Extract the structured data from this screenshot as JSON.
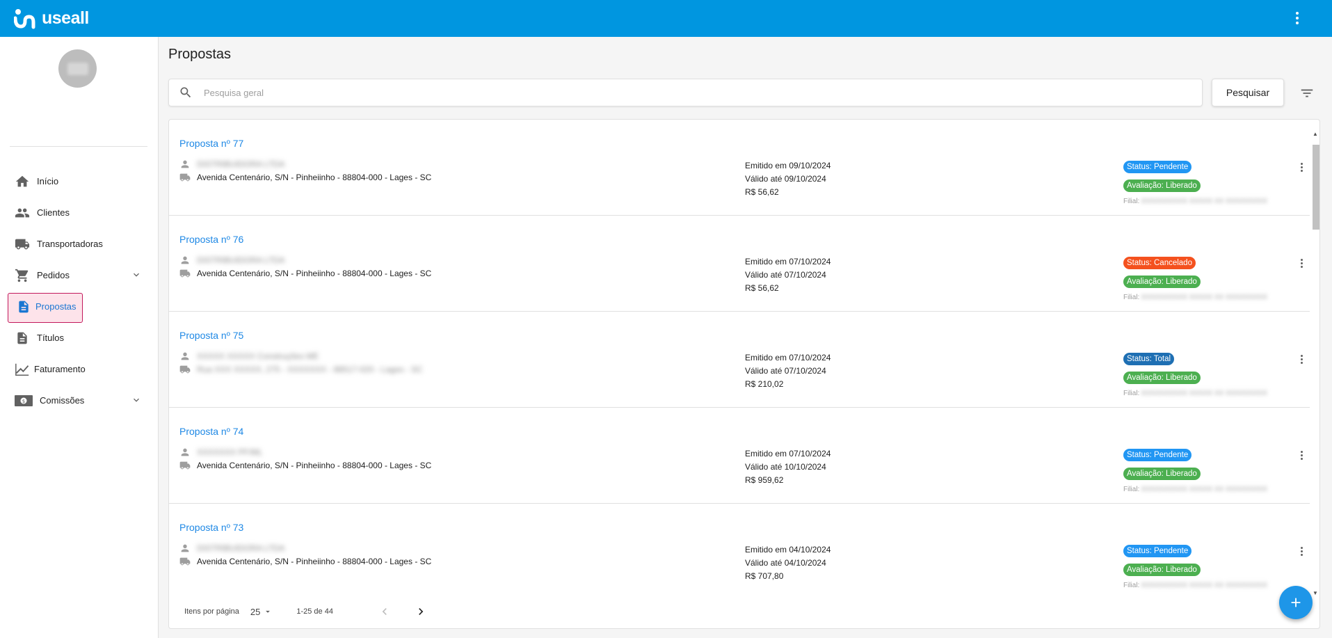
{
  "app": {
    "brand": "useall",
    "accent": "#0096e0"
  },
  "sidebar": {
    "items": [
      {
        "label": "Início",
        "icon": "home-icon"
      },
      {
        "label": "Clientes",
        "icon": "people-icon"
      },
      {
        "label": "Transportadoras",
        "icon": "truck-icon"
      },
      {
        "label": "Pedidos",
        "icon": "cart-icon"
      },
      {
        "label": "Propostas",
        "icon": "document-icon"
      },
      {
        "label": "Títulos",
        "icon": "file-icon"
      },
      {
        "label": "Faturamento",
        "icon": "trending-icon"
      },
      {
        "label": "Comissões",
        "icon": "money-icon"
      }
    ]
  },
  "page": {
    "title": "Propostas"
  },
  "search": {
    "placeholder": "Pesquisa geral",
    "value": "",
    "button": "Pesquisar"
  },
  "proposals": [
    {
      "title": "Proposta nº 77",
      "client": "DISTRIBUIDORA LTDA",
      "address": "Avenida Centenário, S/N - Pinheiinho - 88804-000 - Lages - SC",
      "emitted": "Emitido em 09/10/2024",
      "valid": "Válido até 09/10/2024",
      "value": "R$ 56,62",
      "status": "Status: Pendente",
      "evaluation": "Avaliação: Liberado",
      "filial_label": "Filial:",
      "filial_value": "XXXXXXXXXX XXXXX XX XXXXXXXXX"
    },
    {
      "title": "Proposta nº 76",
      "client": "DISTRIBUIDORA LTDA",
      "address": "Avenida Centenário, S/N - Pinheiinho - 88804-000 - Lages - SC",
      "emitted": "Emitido em 07/10/2024",
      "valid": "Válido até 07/10/2024",
      "value": "R$ 56,62",
      "status": "Status: Cancelado",
      "evaluation": "Avaliação: Liberado",
      "filial_label": "Filial:",
      "filial_value": "XXXXXXXXXX XXXXX XX XXXXXXXXX"
    },
    {
      "title": "Proposta nº 75",
      "client": "XXXXX XXXXX Construções ME",
      "address": "Rua XXX XXXXX, 275 - XXXXXXX - 88517-020 - Lages - SC",
      "emitted": "Emitido em 07/10/2024",
      "valid": "Válido até 07/10/2024",
      "value": "R$ 210,02",
      "status": "Status: Total",
      "evaluation": "Avaliação: Liberado",
      "filial_label": "Filial:",
      "filial_value": "XXXXXXXXXX XXXXX XX XXXXXXXXX"
    },
    {
      "title": "Proposta nº 74",
      "client": "XXXXXXX PF/ML",
      "address": "Avenida Centenário, S/N - Pinheiinho - 88804-000 - Lages - SC",
      "emitted": "Emitido em 07/10/2024",
      "valid": "Válido até 10/10/2024",
      "value": "R$ 959,62",
      "status": "Status: Pendente",
      "evaluation": "Avaliação: Liberado",
      "filial_label": "Filial:",
      "filial_value": "XXXXXXXXXX XXXXX XX XXXXXXXXX"
    },
    {
      "title": "Proposta nº 73",
      "client": "DISTRIBUIDORA LTDA",
      "address": "Avenida Centenário, S/N - Pinheiinho - 88804-000 - Lages - SC",
      "emitted": "Emitido em 04/10/2024",
      "valid": "Válido até 04/10/2024",
      "value": "R$ 707,80",
      "status": "Status: Pendente",
      "evaluation": "Avaliação: Liberado",
      "filial_label": "Filial:",
      "filial_value": "XXXXXXXXXX XXXXX XX XXXXXXXXX"
    }
  ],
  "status_colors": {
    "pendente": "#2196f3",
    "cancelado": "#f4511e",
    "total": "#1e6fb3",
    "liberado": "#4caf50"
  },
  "pagination": {
    "label": "Itens por página",
    "per_page": "25",
    "range": "1-25 de 44"
  }
}
